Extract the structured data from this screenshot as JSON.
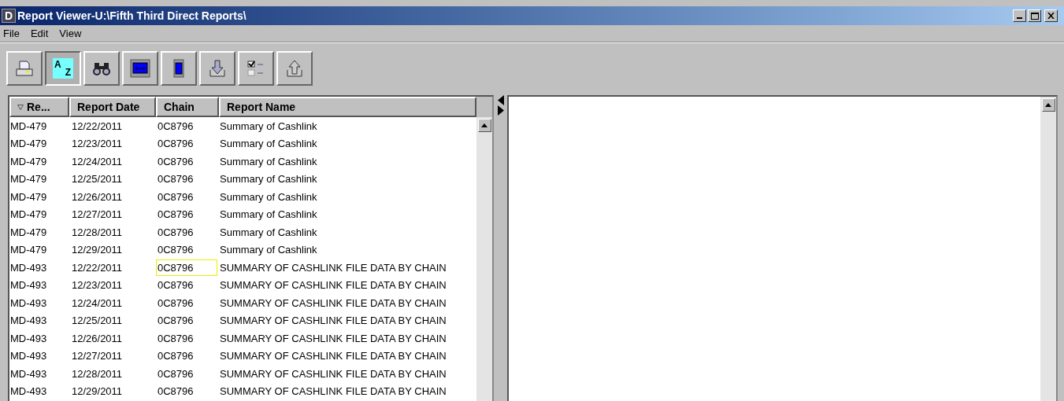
{
  "window": {
    "title": "Report Viewer-U:\\Fifth Third Direct Reports\\",
    "logo": "D"
  },
  "menu": [
    "File",
    "Edit",
    "View"
  ],
  "toolbar": [
    {
      "kind": "print",
      "selected": false
    },
    {
      "kind": "sort",
      "selected": true,
      "letters": [
        "A",
        "Z"
      ]
    },
    {
      "kind": "find",
      "selected": false
    },
    {
      "kind": "fit-width",
      "selected": false
    },
    {
      "kind": "fit-page",
      "selected": false
    },
    {
      "kind": "download",
      "selected": false
    },
    {
      "kind": "checklist",
      "selected": false
    },
    {
      "kind": "upload",
      "selected": false
    }
  ],
  "table": {
    "columns": [
      {
        "label": "Re...",
        "sorted": true
      },
      {
        "label": "Report Date",
        "sorted": false
      },
      {
        "label": "Chain",
        "sorted": false
      },
      {
        "label": "Report Name",
        "sorted": false
      }
    ],
    "rows": [
      {
        "report": "MD-479",
        "date": "12/22/2011",
        "chain": "0C8796",
        "name": "Summary of Cashlink",
        "chain_focused": false
      },
      {
        "report": "MD-479",
        "date": "12/23/2011",
        "chain": "0C8796",
        "name": "Summary of Cashlink",
        "chain_focused": false
      },
      {
        "report": "MD-479",
        "date": "12/24/2011",
        "chain": "0C8796",
        "name": "Summary of Cashlink",
        "chain_focused": false
      },
      {
        "report": "MD-479",
        "date": "12/25/2011",
        "chain": "0C8796",
        "name": "Summary of Cashlink",
        "chain_focused": false
      },
      {
        "report": "MD-479",
        "date": "12/26/2011",
        "chain": "0C8796",
        "name": "Summary of Cashlink",
        "chain_focused": false
      },
      {
        "report": "MD-479",
        "date": "12/27/2011",
        "chain": "0C8796",
        "name": "Summary of Cashlink",
        "chain_focused": false
      },
      {
        "report": "MD-479",
        "date": "12/28/2011",
        "chain": "0C8796",
        "name": "Summary of Cashlink",
        "chain_focused": false
      },
      {
        "report": "MD-479",
        "date": "12/29/2011",
        "chain": "0C8796",
        "name": "Summary of Cashlink",
        "chain_focused": false
      },
      {
        "report": "MD-493",
        "date": "12/22/2011",
        "chain": "0C8796",
        "name": "SUMMARY OF CASHLINK FILE DATA BY CHAIN",
        "chain_focused": true
      },
      {
        "report": "MD-493",
        "date": "12/23/2011",
        "chain": "0C8796",
        "name": "SUMMARY OF CASHLINK FILE DATA BY CHAIN",
        "chain_focused": false
      },
      {
        "report": "MD-493",
        "date": "12/24/2011",
        "chain": "0C8796",
        "name": "SUMMARY OF CASHLINK FILE DATA BY CHAIN",
        "chain_focused": false
      },
      {
        "report": "MD-493",
        "date": "12/25/2011",
        "chain": "0C8796",
        "name": "SUMMARY OF CASHLINK FILE DATA BY CHAIN",
        "chain_focused": false
      },
      {
        "report": "MD-493",
        "date": "12/26/2011",
        "chain": "0C8796",
        "name": "SUMMARY OF CASHLINK FILE DATA BY CHAIN",
        "chain_focused": false
      },
      {
        "report": "MD-493",
        "date": "12/27/2011",
        "chain": "0C8796",
        "name": "SUMMARY OF CASHLINK FILE DATA BY CHAIN",
        "chain_focused": false
      },
      {
        "report": "MD-493",
        "date": "12/28/2011",
        "chain": "0C8796",
        "name": "SUMMARY OF CASHLINK FILE DATA BY CHAIN",
        "chain_focused": false
      },
      {
        "report": "MD-493",
        "date": "12/29/2011",
        "chain": "0C8796",
        "name": "SUMMARY OF CASHLINK FILE DATA BY CHAIN",
        "chain_focused": false
      }
    ]
  }
}
